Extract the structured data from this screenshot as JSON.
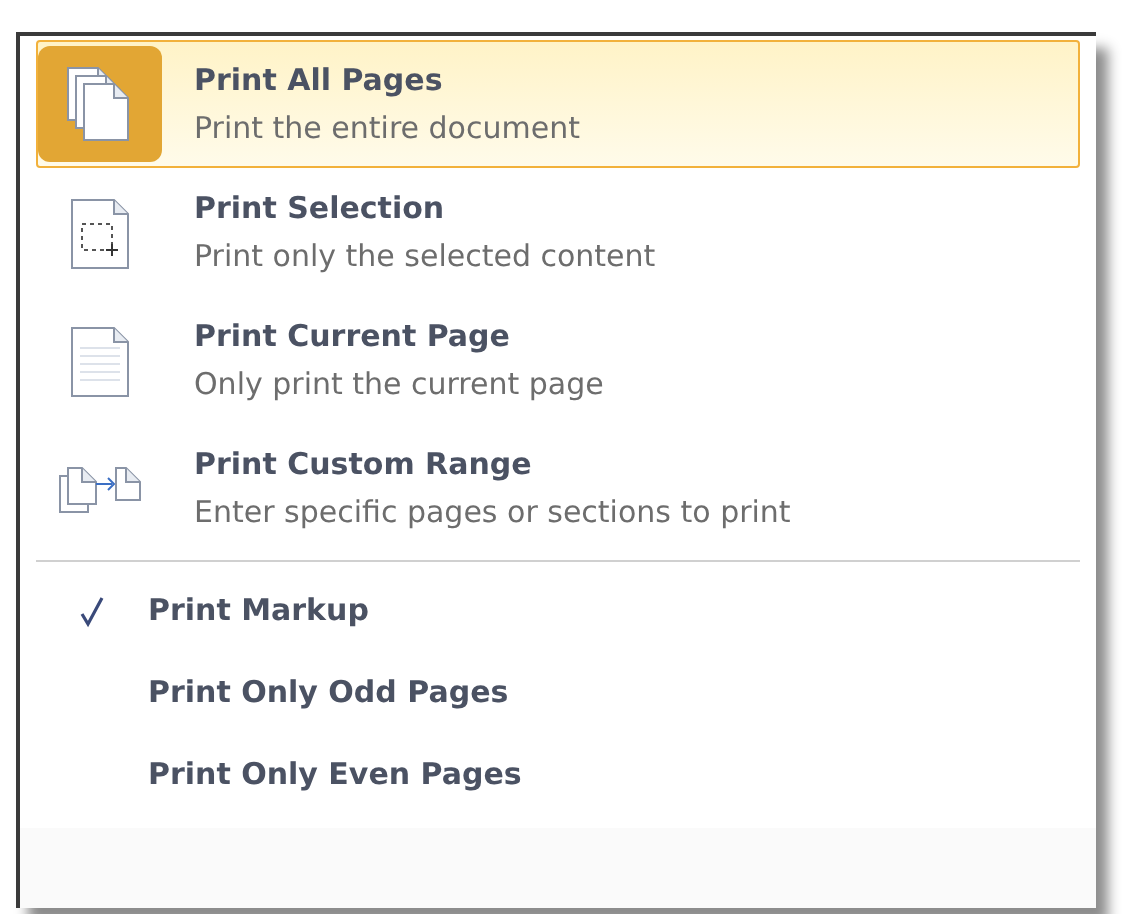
{
  "print_options": [
    {
      "title": "Print All Pages",
      "description": "Print the entire document",
      "selected": true
    },
    {
      "title": "Print Selection",
      "description": "Print only the selected content",
      "selected": false
    },
    {
      "title": "Print Current Page",
      "description": "Only print the current page",
      "selected": false
    },
    {
      "title": "Print Custom Range",
      "description": "Enter specific pages or sections to print",
      "selected": false
    }
  ],
  "toggles": [
    {
      "label": "Print Markup",
      "checked": true
    },
    {
      "label": "Print Only Odd Pages",
      "checked": false
    },
    {
      "label": "Print Only Even Pages",
      "checked": false
    }
  ]
}
